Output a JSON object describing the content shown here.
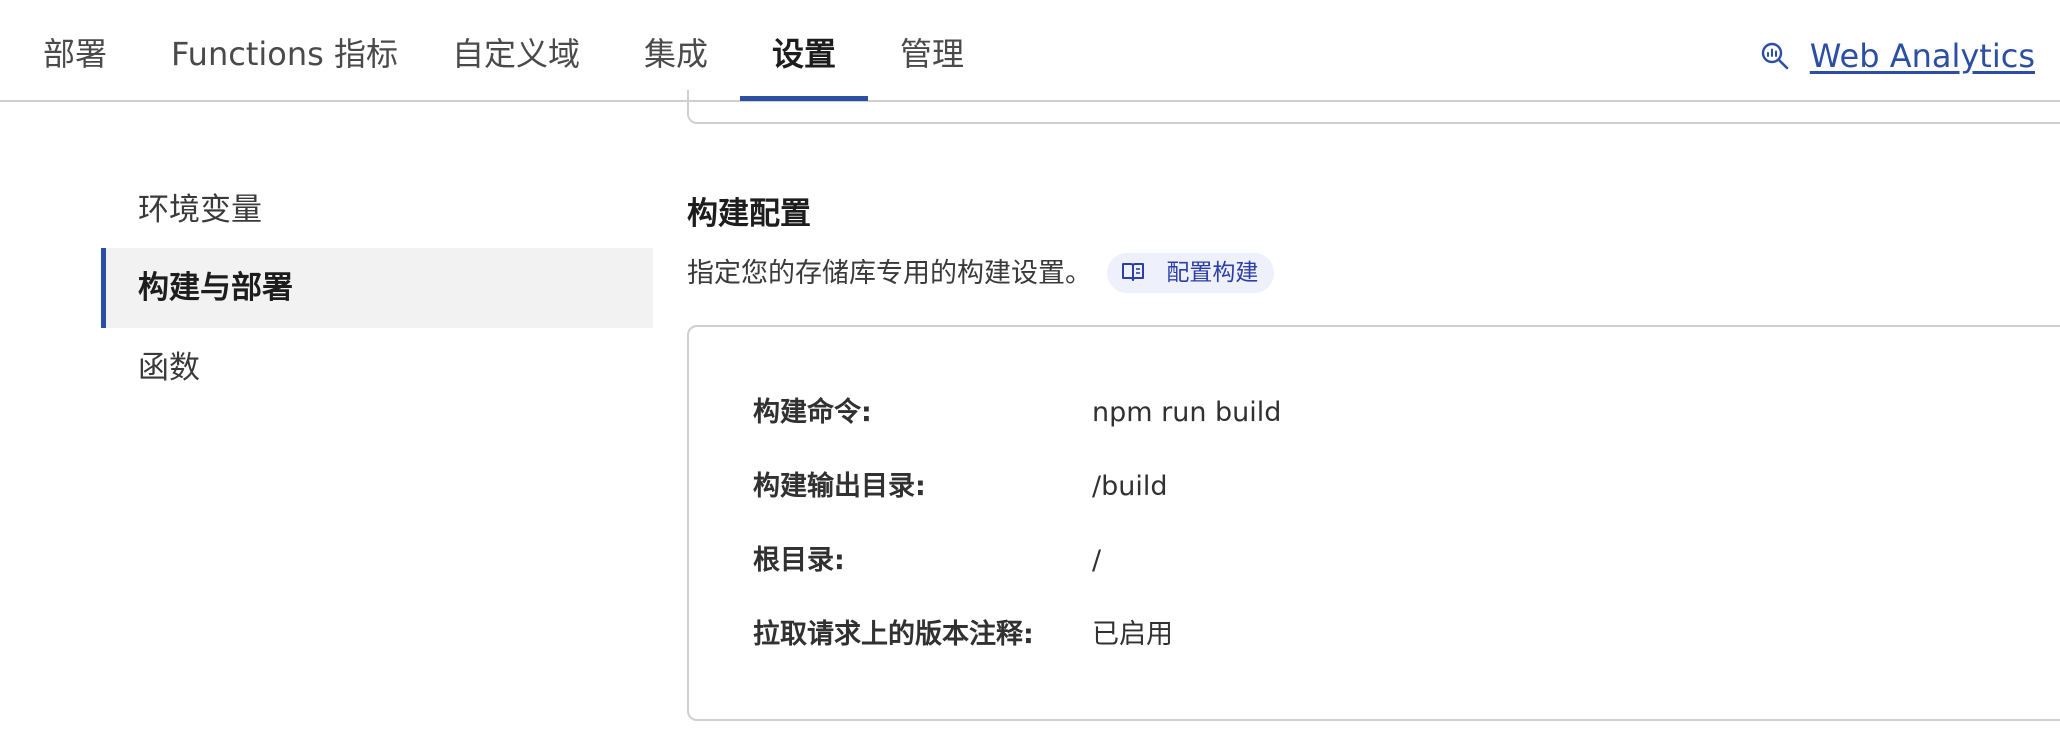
{
  "tabs": [
    {
      "label": "部署"
    },
    {
      "label": "Functions 指标"
    },
    {
      "label": "自定义域"
    },
    {
      "label": "集成"
    },
    {
      "label": "设置",
      "active": true
    },
    {
      "label": "管理"
    }
  ],
  "header_link": {
    "label": "Web Analytics",
    "icon": "analytics-search-icon"
  },
  "sidebar": {
    "items": [
      {
        "label": "环境变量"
      },
      {
        "label": "构建与部署",
        "active": true
      },
      {
        "label": "函数"
      }
    ]
  },
  "build_config": {
    "title": "构建配置",
    "description": "指定您的存储库专用的构建设置。",
    "doc_link": {
      "label": "配置构建",
      "icon": "book-icon"
    },
    "rows": [
      {
        "label": "构建命令:",
        "value": "npm run build"
      },
      {
        "label": "构建输出目录:",
        "value": "/build"
      },
      {
        "label": "根目录:",
        "value": "/"
      },
      {
        "label": "拉取请求上的版本注释:",
        "value": "已启用"
      }
    ]
  },
  "colors": {
    "accent": "#2c4fa3",
    "pill_bg": "#eef0fb",
    "pill_text": "#2c3ea8",
    "active_bg": "#f2f2f2",
    "border": "#cfcfcf"
  }
}
